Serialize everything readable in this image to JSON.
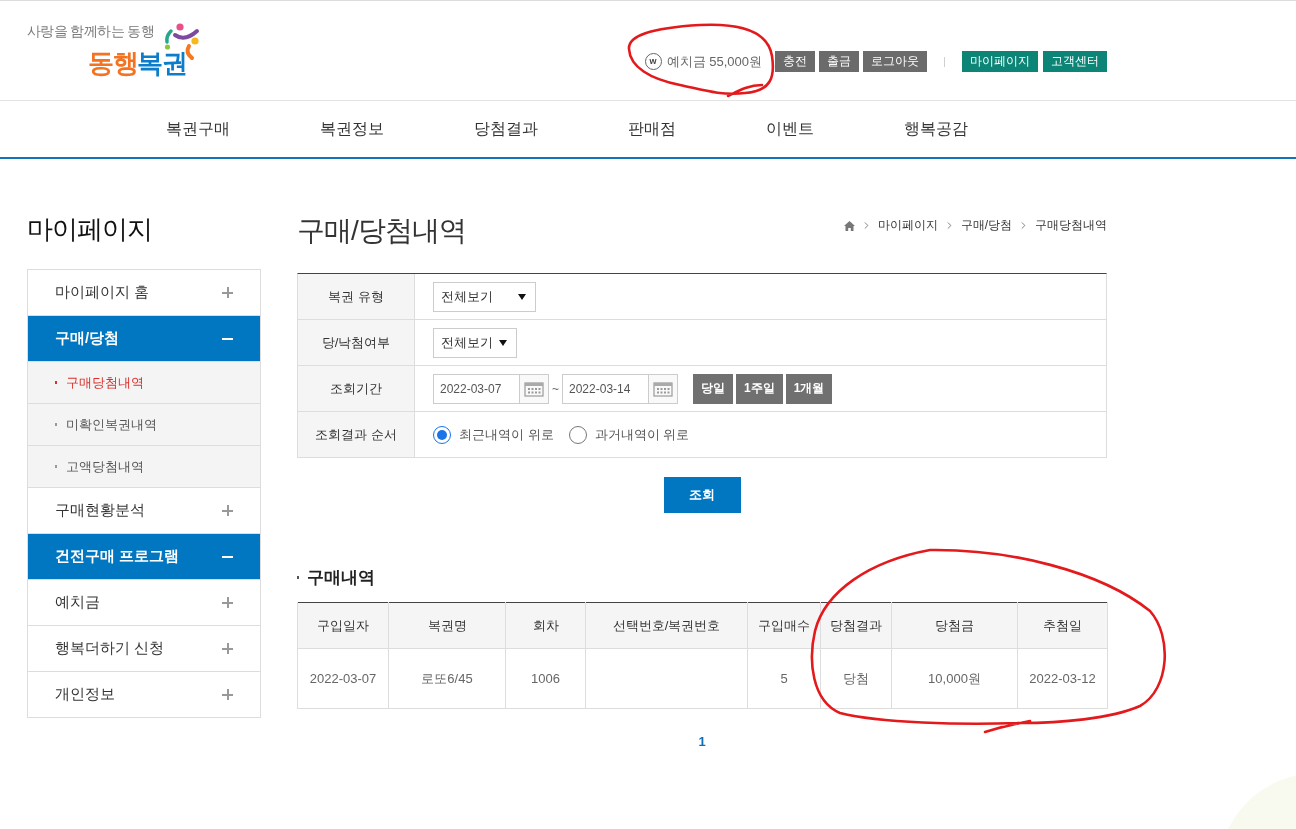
{
  "logo": {
    "tagline": "사랑을 함께하는 동행",
    "wordmark": [
      {
        "text": "동행",
        "color": "#f37321"
      },
      {
        "text": "복권",
        "color": "#0b7dcb"
      }
    ]
  },
  "account": {
    "deposit_icon": "w",
    "deposit": "예치금 55,000원",
    "buttons": [
      {
        "label": "충전",
        "kind": "account"
      },
      {
        "label": "출금",
        "kind": "account"
      },
      {
        "label": "로그아웃",
        "kind": "account"
      },
      {
        "label": "마이페이지",
        "kind": "service"
      },
      {
        "label": "고객센터",
        "kind": "service"
      }
    ]
  },
  "nav": [
    "복권구매",
    "복권정보",
    "당첨결과",
    "판매점",
    "이벤트",
    "행복공감"
  ],
  "sidebar": {
    "title": "마이페이지",
    "items": [
      {
        "label": "마이페이지 홈",
        "expanded": false
      },
      {
        "label": "구매/당첨",
        "expanded": true,
        "children": [
          {
            "label": "구매당첨내역",
            "selected": true
          },
          {
            "label": "미확인복권내역",
            "selected": false
          },
          {
            "label": "고액당첨내역",
            "selected": false
          }
        ]
      },
      {
        "label": "구매현황분석",
        "expanded": false
      },
      {
        "label": "건전구매 프로그램",
        "expanded": true
      },
      {
        "label": "예치금",
        "expanded": false
      },
      {
        "label": "행복더하기 신청",
        "expanded": false
      },
      {
        "label": "개인정보",
        "expanded": false
      }
    ]
  },
  "page_title": "구매/당첨내역",
  "breadcrumb": [
    "마이페이지",
    "구매/당첨",
    "구매당첨내역"
  ],
  "filters": [
    {
      "label": "복권 유형",
      "kind": "select",
      "value": "전체보기"
    },
    {
      "label": "당/낙첨여부",
      "kind": "select",
      "value": "전체보기"
    },
    {
      "label": "조회기간",
      "kind": "date_range",
      "from": "2022-03-07",
      "to": "2022-03-14",
      "separator": "~",
      "presets": [
        "당일",
        "1주일",
        "1개월"
      ]
    },
    {
      "label": "조회결과 순서",
      "kind": "radio",
      "options": [
        {
          "label": "최근내역이 위로",
          "selected": true
        },
        {
          "label": "과거내역이 위로",
          "selected": false
        }
      ]
    }
  ],
  "search_button": "조회",
  "purchases": {
    "title": "구매내역",
    "columns": [
      "구입일자",
      "복권명",
      "회차",
      "선택번호/복권번호",
      "구입매수",
      "당첨결과",
      "당첨금",
      "추첨일"
    ],
    "rows": [
      {
        "cells": [
          "2022-03-07",
          "로또6/45",
          "1006",
          null,
          "5",
          "당첨",
          "10,000원",
          "2022-03-12"
        ]
      }
    ]
  },
  "pagination": {
    "pages": [
      {
        "label": "1",
        "selected": true
      }
    ]
  },
  "annotations": [
    {
      "kind": "freehand_loop"
    },
    {
      "kind": "freehand_loop"
    }
  ]
}
